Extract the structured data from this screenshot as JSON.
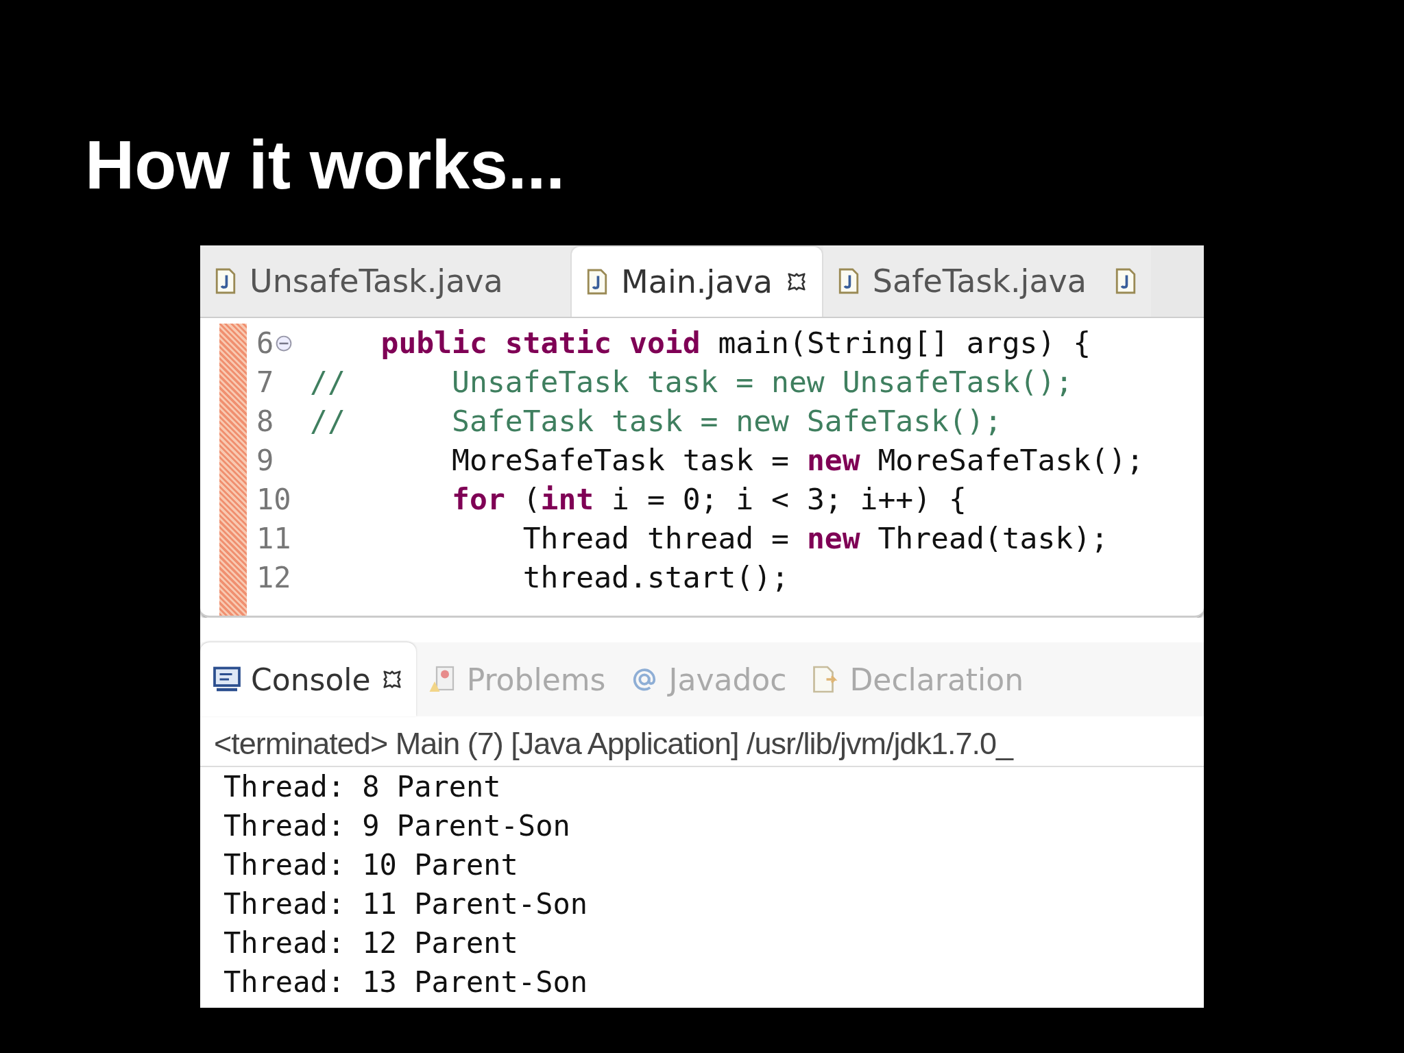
{
  "slide": {
    "title": "How it works..."
  },
  "editor": {
    "tabs": [
      {
        "label": "UnsafeTask.java",
        "selected": false,
        "closable": false
      },
      {
        "label": "Main.java",
        "selected": true,
        "closable": true
      },
      {
        "label": "SafeTask.java",
        "selected": false,
        "closable": false
      },
      {
        "selected": false,
        "closable": false
      }
    ],
    "lines": [
      {
        "number": "6",
        "folded": false,
        "tokens": [
          {
            "t": "    public static void",
            "kind": "keyword"
          },
          {
            "t": " main(String[] args) {"
          }
        ]
      },
      {
        "number": "7",
        "tokens": [
          {
            "t": "//      UnsafeTask task = new UnsafeTask();",
            "kind": "comment"
          }
        ]
      },
      {
        "number": "8",
        "tokens": [
          {
            "t": "//      SafeTask task = new SafeTask();",
            "kind": "comment"
          }
        ]
      },
      {
        "number": "9",
        "tokens": [
          {
            "t": "        MoreSafeTask task = "
          },
          {
            "t": "new",
            "kind": "keyword"
          },
          {
            "t": " MoreSafeTask();"
          }
        ]
      },
      {
        "number": "10",
        "tokens": [
          {
            "t": "        for",
            "kind": "keyword"
          },
          {
            "t": " ("
          },
          {
            "t": "int",
            "kind": "keyword"
          },
          {
            "t": " i = 0; i < 3; i++) {"
          }
        ]
      },
      {
        "number": "11",
        "tokens": [
          {
            "t": "            Thread thread = "
          },
          {
            "t": "new",
            "kind": "keyword"
          },
          {
            "t": " Thread(task);"
          }
        ]
      },
      {
        "number": "12",
        "tokens": [
          {
            "t": "            thread.start();"
          }
        ]
      }
    ]
  },
  "console": {
    "tabs": [
      {
        "label": "Console",
        "kind": "console",
        "selected": true,
        "closable": true
      },
      {
        "label": "Problems",
        "kind": "problems",
        "selected": false,
        "closable": false
      },
      {
        "label": "Javadoc",
        "kind": "javadoc",
        "selected": false,
        "closable": false
      },
      {
        "label": "Declaration",
        "kind": "declaration",
        "selected": false,
        "closable": false
      }
    ],
    "header": "<terminated> Main (7) [Java Application] /usr/lib/jvm/jdk1.7.0_",
    "output": [
      "Thread: 8 Parent",
      "Thread: 9 Parent-Son",
      "Thread: 10 Parent",
      "Thread: 11 Parent-Son",
      "Thread: 12 Parent",
      "Thread: 13 Parent-Son"
    ]
  }
}
